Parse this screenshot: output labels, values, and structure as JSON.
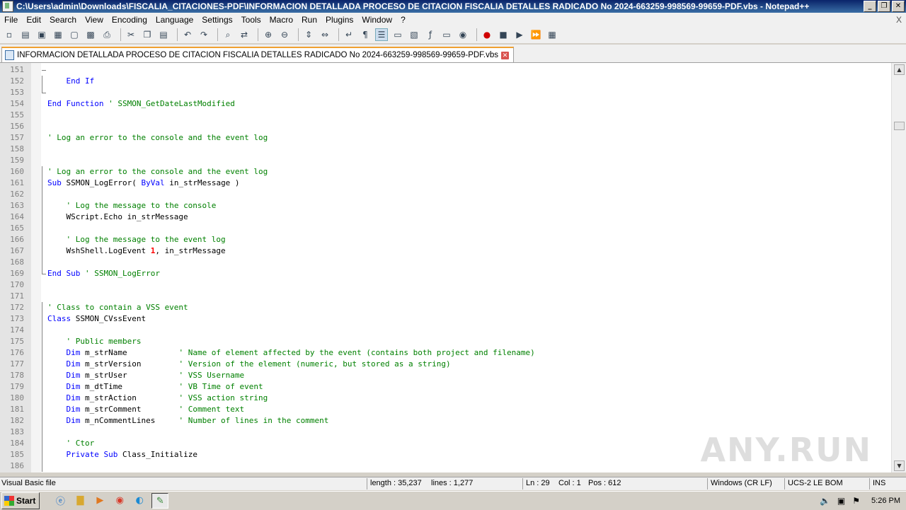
{
  "window": {
    "title": "C:\\Users\\admin\\Downloads\\FISCALIA_CITACIONES-PDF\\INFORMACION DETALLADA PROCESO DE CITACION FISCALIA DETALLES RADICADO No 2024-663259-998569-99659-PDF.vbs - Notepad++",
    "minimize": "_",
    "restore": "❐",
    "close": "✕"
  },
  "menu": [
    "File",
    "Edit",
    "Search",
    "View",
    "Encoding",
    "Language",
    "Settings",
    "Tools",
    "Macro",
    "Run",
    "Plugins",
    "Window",
    "?"
  ],
  "menu_close": "X",
  "toolbar": [
    {
      "icon": "new-file-icon",
      "glyph": "▫"
    },
    {
      "icon": "open-file-icon",
      "glyph": "▤"
    },
    {
      "icon": "save-icon",
      "glyph": "▣"
    },
    {
      "icon": "save-all-icon",
      "glyph": "▦"
    },
    {
      "icon": "close-icon",
      "glyph": "▢"
    },
    {
      "icon": "close-all-icon",
      "glyph": "▩"
    },
    {
      "icon": "print-icon",
      "glyph": "⎙"
    },
    {
      "sep": true
    },
    {
      "icon": "cut-icon",
      "glyph": "✂"
    },
    {
      "icon": "copy-icon",
      "glyph": "❐"
    },
    {
      "icon": "paste-icon",
      "glyph": "▤"
    },
    {
      "sep": true
    },
    {
      "icon": "undo-icon",
      "glyph": "↶"
    },
    {
      "icon": "redo-icon",
      "glyph": "↷"
    },
    {
      "sep": true
    },
    {
      "icon": "find-icon",
      "glyph": "⌕"
    },
    {
      "icon": "replace-icon",
      "glyph": "⇄"
    },
    {
      "sep": true
    },
    {
      "icon": "zoom-in-icon",
      "glyph": "⊕"
    },
    {
      "icon": "zoom-out-icon",
      "glyph": "⊖"
    },
    {
      "sep": true
    },
    {
      "icon": "sync-vertical-icon",
      "glyph": "⇕"
    },
    {
      "icon": "sync-horizontal-icon",
      "glyph": "⇔"
    },
    {
      "sep": true
    },
    {
      "icon": "word-wrap-icon",
      "glyph": "↵"
    },
    {
      "icon": "show-all-chars-icon",
      "glyph": "¶"
    },
    {
      "icon": "indent-guide-icon",
      "glyph": "☰",
      "active": true
    },
    {
      "icon": "language-define-icon",
      "glyph": "▭"
    },
    {
      "icon": "doc-map-icon",
      "glyph": "▧"
    },
    {
      "icon": "function-list-icon",
      "glyph": "ƒ"
    },
    {
      "icon": "folder-workspace-icon",
      "glyph": "▭"
    },
    {
      "icon": "monitoring-icon",
      "glyph": "◉"
    },
    {
      "sep": true
    },
    {
      "icon": "record-macro-icon",
      "glyph": "●",
      "color": "#d00000"
    },
    {
      "icon": "stop-record-icon",
      "glyph": "■"
    },
    {
      "icon": "play-macro-icon",
      "glyph": "▶"
    },
    {
      "icon": "play-multiple-icon",
      "glyph": "⏩"
    },
    {
      "icon": "save-macro-icon",
      "glyph": "▦"
    }
  ],
  "tab": {
    "label": "INFORMACION DETALLADA PROCESO DE CITACION FISCALIA DETALLES RADICADO No 2024-663259-998569-99659-PDF.vbs",
    "close": "✕"
  },
  "code_lines": [
    {
      "n": "151",
      "fold": "mid",
      "tokens": []
    },
    {
      "n": "152",
      "fold": "v",
      "tokens": [
        [
          "id",
          "    "
        ],
        [
          "kw",
          "End If"
        ]
      ]
    },
    {
      "n": "153",
      "fold": "end",
      "tokens": []
    },
    {
      "n": "154",
      "fold": "",
      "tokens": [
        [
          "kw",
          "End Function"
        ],
        [
          "id",
          " "
        ],
        [
          "cm",
          "' SSMON_GetDateLastModified"
        ]
      ]
    },
    {
      "n": "155",
      "fold": "",
      "tokens": []
    },
    {
      "n": "156",
      "fold": "",
      "tokens": []
    },
    {
      "n": "157",
      "fold": "",
      "tokens": [
        [
          "cm",
          "' Log an error to the console and the event log"
        ]
      ]
    },
    {
      "n": "158",
      "fold": "",
      "tokens": []
    },
    {
      "n": "159",
      "fold": "",
      "tokens": []
    },
    {
      "n": "160",
      "fold": "v",
      "tokens": [
        [
          "cm",
          "' Log an error to the console and the event log"
        ]
      ]
    },
    {
      "n": "161",
      "fold": "v",
      "tokens": [
        [
          "kw",
          "Sub"
        ],
        [
          "id",
          " SSMON_LogError( "
        ],
        [
          "kw",
          "ByVal"
        ],
        [
          "id",
          " in_strMessage )"
        ]
      ]
    },
    {
      "n": "162",
      "fold": "v",
      "tokens": []
    },
    {
      "n": "163",
      "fold": "v",
      "tokens": [
        [
          "id",
          "    "
        ],
        [
          "cm",
          "' Log the message to the console"
        ]
      ]
    },
    {
      "n": "164",
      "fold": "v",
      "tokens": [
        [
          "id",
          "    WScript.Echo in_strMessage"
        ]
      ]
    },
    {
      "n": "165",
      "fold": "v",
      "tokens": []
    },
    {
      "n": "166",
      "fold": "v",
      "tokens": [
        [
          "id",
          "    "
        ],
        [
          "cm",
          "' Log the message to the event log"
        ]
      ]
    },
    {
      "n": "167",
      "fold": "v",
      "tokens": [
        [
          "id",
          "    WshShell.LogEvent "
        ],
        [
          "nm",
          "1"
        ],
        [
          "id",
          ", in_strMessage"
        ]
      ]
    },
    {
      "n": "168",
      "fold": "v",
      "tokens": []
    },
    {
      "n": "169",
      "fold": "end",
      "tokens": [
        [
          "kw",
          "End Sub"
        ],
        [
          "id",
          " "
        ],
        [
          "cm",
          "' SSMON_LogError"
        ]
      ]
    },
    {
      "n": "170",
      "fold": "",
      "tokens": []
    },
    {
      "n": "171",
      "fold": "",
      "tokens": []
    },
    {
      "n": "172",
      "fold": "v",
      "tokens": [
        [
          "cm",
          "' Class to contain a VSS event"
        ]
      ]
    },
    {
      "n": "173",
      "fold": "v",
      "tokens": [
        [
          "kw",
          "Class"
        ],
        [
          "id",
          " SSMON_CVssEvent"
        ]
      ]
    },
    {
      "n": "174",
      "fold": "v",
      "tokens": []
    },
    {
      "n": "175",
      "fold": "v",
      "tokens": [
        [
          "id",
          "    "
        ],
        [
          "cm",
          "' Public members"
        ]
      ]
    },
    {
      "n": "176",
      "fold": "v",
      "tokens": [
        [
          "id",
          "    "
        ],
        [
          "kw",
          "Dim"
        ],
        [
          "id",
          " m_strName           "
        ],
        [
          "cm",
          "' Name of element affected by the event (contains both project and filename)"
        ]
      ]
    },
    {
      "n": "177",
      "fold": "v",
      "tokens": [
        [
          "id",
          "    "
        ],
        [
          "kw",
          "Dim"
        ],
        [
          "id",
          " m_strVersion        "
        ],
        [
          "cm",
          "' Version of the element (numeric, but stored as a string)"
        ]
      ]
    },
    {
      "n": "178",
      "fold": "v",
      "tokens": [
        [
          "id",
          "    "
        ],
        [
          "kw",
          "Dim"
        ],
        [
          "id",
          " m_strUser           "
        ],
        [
          "cm",
          "' VSS Username"
        ]
      ]
    },
    {
      "n": "179",
      "fold": "v",
      "tokens": [
        [
          "id",
          "    "
        ],
        [
          "kw",
          "Dim"
        ],
        [
          "id",
          " m_dtTime            "
        ],
        [
          "cm",
          "' VB Time of event"
        ]
      ]
    },
    {
      "n": "180",
      "fold": "v",
      "tokens": [
        [
          "id",
          "    "
        ],
        [
          "kw",
          "Dim"
        ],
        [
          "id",
          " m_strAction         "
        ],
        [
          "cm",
          "' VSS action string"
        ]
      ]
    },
    {
      "n": "181",
      "fold": "v",
      "tokens": [
        [
          "id",
          "    "
        ],
        [
          "kw",
          "Dim"
        ],
        [
          "id",
          " m_strComment        "
        ],
        [
          "cm",
          "' Comment text"
        ]
      ]
    },
    {
      "n": "182",
      "fold": "v",
      "tokens": [
        [
          "id",
          "    "
        ],
        [
          "kw",
          "Dim"
        ],
        [
          "id",
          " m_nCommentLines     "
        ],
        [
          "cm",
          "' Number of lines in the comment"
        ]
      ]
    },
    {
      "n": "183",
      "fold": "v",
      "tokens": []
    },
    {
      "n": "184",
      "fold": "v",
      "tokens": [
        [
          "id",
          "    "
        ],
        [
          "cm",
          "' Ctor"
        ]
      ]
    },
    {
      "n": "185",
      "fold": "v",
      "tokens": [
        [
          "id",
          "    "
        ],
        [
          "kw",
          "Private Sub"
        ],
        [
          "id",
          " Class_Initialize"
        ]
      ]
    },
    {
      "n": "186",
      "fold": "v",
      "tokens": []
    }
  ],
  "scroll": {
    "up": "▲",
    "down": "▼"
  },
  "watermark": "ANY.RUN",
  "status": {
    "file_type": "Visual Basic file",
    "length": "length : 35,237",
    "lines": "lines : 1,277",
    "ln": "Ln : 29",
    "col": "Col : 1",
    "pos": "Pos : 612",
    "eol": "Windows (CR LF)",
    "encoding": "UCS-2 LE BOM",
    "mode": "INS"
  },
  "taskbar": {
    "start": "Start",
    "quick": [
      {
        "icon": "internet-explorer-icon",
        "glyph": "ⓔ",
        "color": "#1e6fc8"
      },
      {
        "icon": "file-explorer-icon",
        "glyph": "▇",
        "color": "#d8a830"
      },
      {
        "icon": "media-player-icon",
        "glyph": "▶",
        "color": "#e07820"
      },
      {
        "icon": "chrome-icon",
        "glyph": "◉",
        "color": "#d83a2a"
      },
      {
        "icon": "edge-icon",
        "glyph": "◐",
        "color": "#1a8ad4"
      },
      {
        "icon": "notepadpp-icon",
        "glyph": "✎",
        "color": "#3a8a3a",
        "active": true
      }
    ],
    "tray": [
      {
        "icon": "volume-icon",
        "glyph": "🔈"
      },
      {
        "icon": "network-icon",
        "glyph": "▣"
      },
      {
        "icon": "action-center-flag-icon",
        "glyph": "⚑"
      }
    ],
    "clock": "5:26 PM"
  }
}
